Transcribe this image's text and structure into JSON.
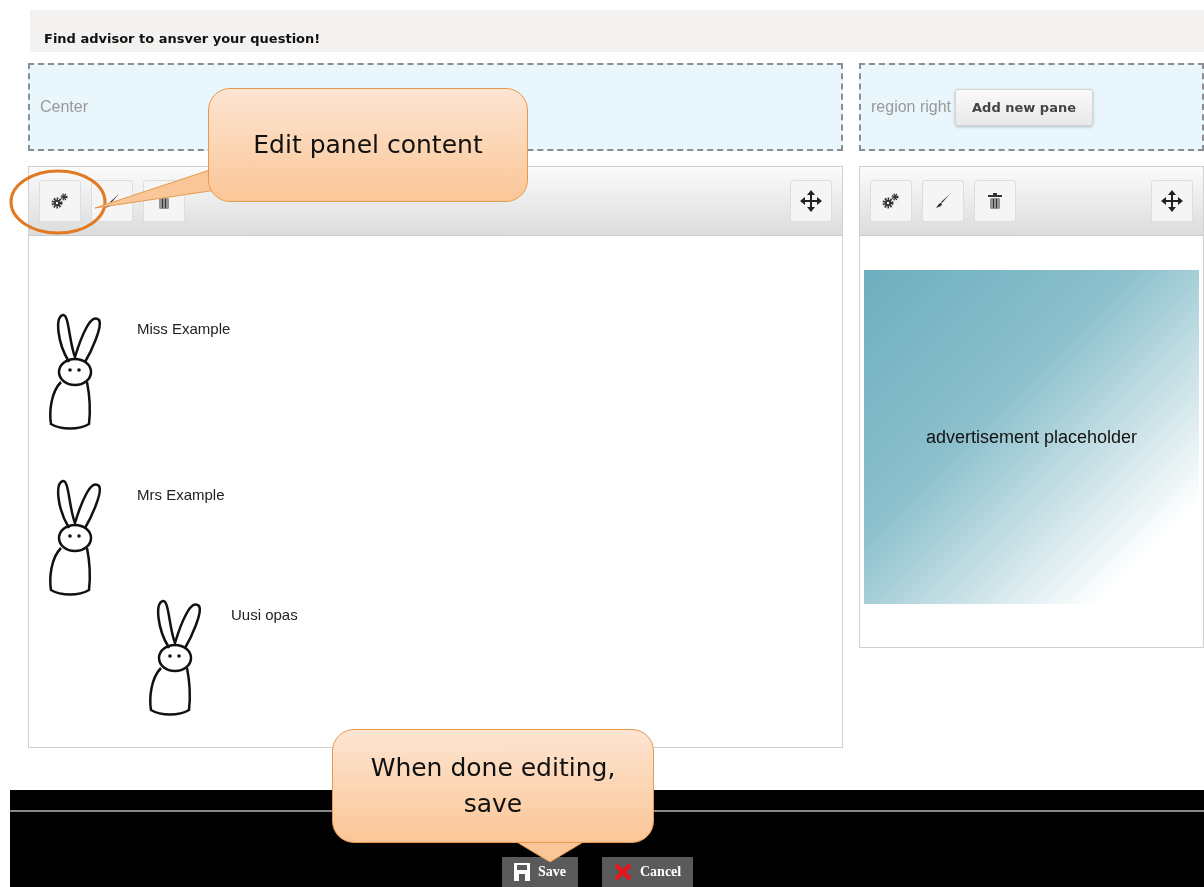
{
  "page_title": "Find advisor to ansver your question!",
  "regions": [
    {
      "label": "Center"
    },
    {
      "label": "region right",
      "button": "Add new pane"
    }
  ],
  "center_panel": {
    "advisors": [
      {
        "name": "Miss Example"
      },
      {
        "name": "Mrs Example"
      },
      {
        "name": "Uusi opas"
      }
    ]
  },
  "right_panel": {
    "advertisement": "advertisement placeholder"
  },
  "callouts": [
    {
      "text": "Edit panel content",
      "kind": "toolbar"
    },
    {
      "text": "When done editing, save",
      "kind": "footer"
    }
  ],
  "footer": {
    "buttons": [
      {
        "kind": "save",
        "label": "Save"
      },
      {
        "kind": "cancel",
        "label": "Cancel"
      }
    ]
  }
}
